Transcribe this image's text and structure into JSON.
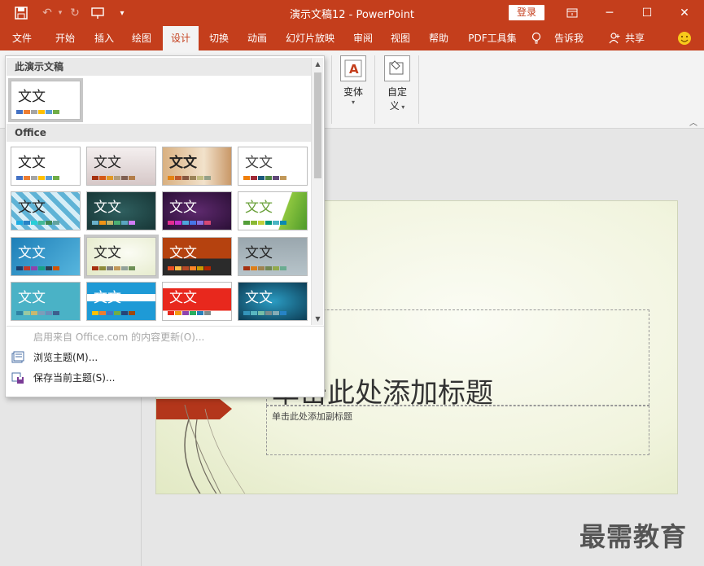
{
  "titlebar": {
    "title": "演示文稿12  -  PowerPoint",
    "login_label": "登录",
    "icons": [
      "save-icon",
      "undo-icon",
      "redo-icon",
      "slideshow-icon",
      "customize-qa-icon",
      "ribbon-display-icon",
      "minimize-icon",
      "maximize-icon",
      "close-icon"
    ]
  },
  "tabs": [
    {
      "label": "文件"
    },
    {
      "label": "开始"
    },
    {
      "label": "插入"
    },
    {
      "label": "绘图"
    },
    {
      "label": "设计"
    },
    {
      "label": "切换"
    },
    {
      "label": "动画"
    },
    {
      "label": "幻灯片放映"
    },
    {
      "label": "审阅"
    },
    {
      "label": "视图"
    },
    {
      "label": "帮助"
    },
    {
      "label": "PDF工具集"
    },
    {
      "label": "告诉我"
    },
    {
      "label": "共享"
    }
  ],
  "active_tab": "设计",
  "ribbon": {
    "variants_label": "变体",
    "customize_label": "自定\n义",
    "customize_line1": "自定",
    "customize_line2": "义"
  },
  "gallery": {
    "section_current": "此演示文稿",
    "section_office": "Office",
    "thumb_text": "文文",
    "menu": {
      "enable_updates": "启用来自 Office.com 的内容更新(O)...",
      "browse": "浏览主题(M)...",
      "save": "保存当前主题(S)..."
    }
  },
  "slide": {
    "title_placeholder": "单击此处添加标题",
    "title_visible": "单击此处添加标题",
    "subtitle_placeholder": "单击此处添加副标题"
  },
  "watermark": "最需教育",
  "colors": {
    "accent": "#c43e1c",
    "ribbon_bg": "#f3f3f3"
  }
}
